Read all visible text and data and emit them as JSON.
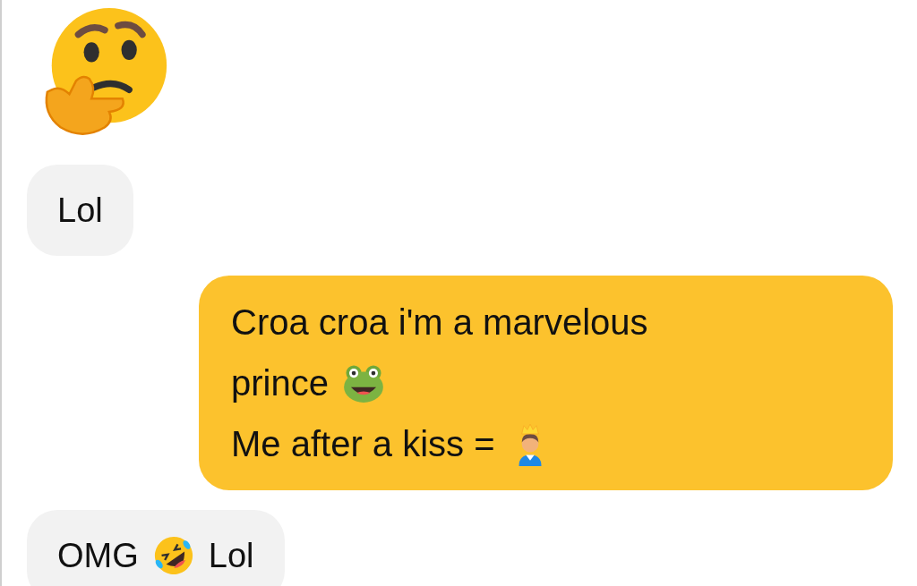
{
  "messages": [
    {
      "kind": "sticker",
      "parts": [
        {
          "kind": "thinking"
        }
      ]
    },
    {
      "outgoing": false,
      "kind": "bubble",
      "lines": [
        [
          {
            "kind": "text",
            "text": "Lol"
          }
        ]
      ]
    },
    {
      "outgoing": true,
      "kind": "bubble",
      "lines": [
        [
          {
            "kind": "text",
            "text": "Croa croa i'm a marvelous"
          }
        ],
        [
          {
            "kind": "text",
            "text": "prince"
          },
          {
            "kind": "frog"
          }
        ],
        [
          {
            "kind": "text",
            "text": "Me after a kiss ="
          },
          {
            "kind": "prince"
          }
        ]
      ]
    },
    {
      "outgoing": false,
      "kind": "bubble",
      "lines": [
        [
          {
            "kind": "text",
            "text": "OMG"
          },
          {
            "kind": "laughing"
          },
          {
            "kind": "text",
            "text": "Lol"
          }
        ]
      ]
    }
  ]
}
